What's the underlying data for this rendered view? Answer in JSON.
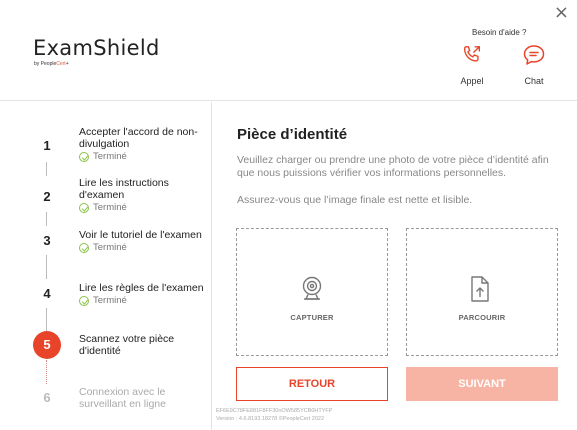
{
  "window": {
    "close_glyph": "×"
  },
  "brand": {
    "name": "ExamShield",
    "by": "by People",
    "by_accent": "Cert",
    "by_mark": "+"
  },
  "help": {
    "question": "Besoin d'aide ?",
    "call_label": "Appel",
    "chat_label": "Chat",
    "call_icon": "phone-call-icon",
    "chat_icon": "chat-bubble-icon"
  },
  "steps": [
    {
      "number": "1",
      "label": "Accepter l'accord de non-divulgation",
      "status": "Terminé",
      "state": "done"
    },
    {
      "number": "2",
      "label": "Lire les instructions d'examen",
      "status": "Terminé",
      "state": "done"
    },
    {
      "number": "3",
      "label": "Voir le tutoriel de l'examen",
      "status": "Terminé",
      "state": "done"
    },
    {
      "number": "4",
      "label": "Lire les règles de l'examen",
      "status": "Terminé",
      "state": "done"
    },
    {
      "number": "5",
      "label": "Scannez votre pièce d'identité",
      "status": "",
      "state": "active"
    },
    {
      "number": "6",
      "label": "Connexion avec le surveillant en ligne",
      "status": "",
      "state": "pending"
    }
  ],
  "main": {
    "title": "Pièce d’identité",
    "description": "Veuillez charger ou prendre une photo de votre pièce d’identité afin que nous puissions vérifier vos informations personnelles.",
    "hint": "Assurez-vous que l’image finale est nette et lisible.",
    "capture_label": "CAPTURER",
    "browse_label": "PARCOURIR",
    "back_label": "RETOUR",
    "next_label": "SUIVANT",
    "session_id": "EF6E9C78FE881F8FF30nOW585YCB0HTYFP",
    "version": "Version : 4.6.8193.18278 ©PeopleCert 2022"
  },
  "colors": {
    "accent": "#e8442a",
    "accent_light": "#f7b4a4",
    "check": "#8bc34a"
  }
}
